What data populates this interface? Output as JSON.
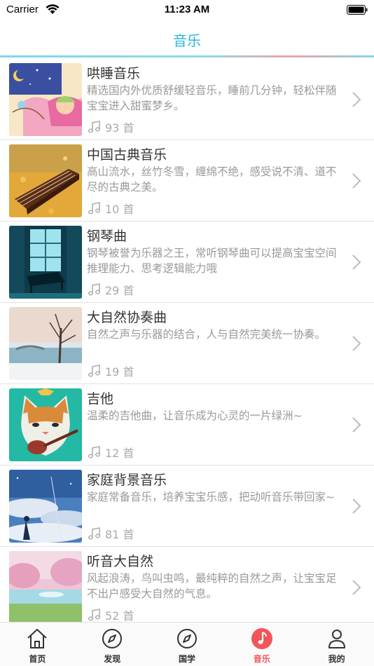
{
  "status_bar": {
    "carrier": "Carrier",
    "time": "11:23 AM"
  },
  "nav": {
    "title": "音乐"
  },
  "colors": {
    "accent": "#29b6d9",
    "active_tab": "#f2555a"
  },
  "items": [
    {
      "title": "哄睡音乐",
      "desc": "精选国内外优质舒缓轻音乐，睡前几分钟，轻松伴随宝宝进入甜蜜梦乡。",
      "count": "93 首",
      "thumb": "sleeping-girl-illustration"
    },
    {
      "title": "中国古典音乐",
      "desc": "高山流水，丝竹冬雪，缠绵不绝，感受说不清、道不尽的古典之美。",
      "count": "10 首",
      "thumb": "guzheng-autumn-leaves"
    },
    {
      "title": "钢琴曲",
      "desc": "钢琴被誉为乐器之王，常听钢琴曲可以提高宝宝空间推理能力、思考逻辑能力哦",
      "count": "29 首",
      "thumb": "piano-by-window"
    },
    {
      "title": "大自然协奏曲",
      "desc": "自然之声与乐器的结合，人与自然完美统一协奏。",
      "count": "19 首",
      "thumb": "winter-tree-lake"
    },
    {
      "title": "吉他",
      "desc": "温柔的吉他曲，让音乐成为心灵的一片绿洲~",
      "count": "12 首",
      "thumb": "cat-with-ukulele"
    },
    {
      "title": "家庭背景音乐",
      "desc": "家庭常备音乐，培养宝宝乐感，把动听音乐带回家~",
      "count": "81 首",
      "thumb": "girl-under-sky"
    },
    {
      "title": "听音大自然",
      "desc": "风起浪涛，鸟叫虫鸣，最纯粹的自然之声，让宝宝足不出户感受大自然的气息。",
      "count": "52 首",
      "thumb": "pink-blossom-landscape"
    }
  ],
  "tabs": [
    {
      "label": "首页",
      "icon": "home-icon",
      "active": false
    },
    {
      "label": "发现",
      "icon": "compass-icon",
      "active": false
    },
    {
      "label": "国学",
      "icon": "compass-icon",
      "active": false
    },
    {
      "label": "音乐",
      "icon": "music-note-icon",
      "active": true
    },
    {
      "label": "我的",
      "icon": "person-icon",
      "active": false
    }
  ]
}
